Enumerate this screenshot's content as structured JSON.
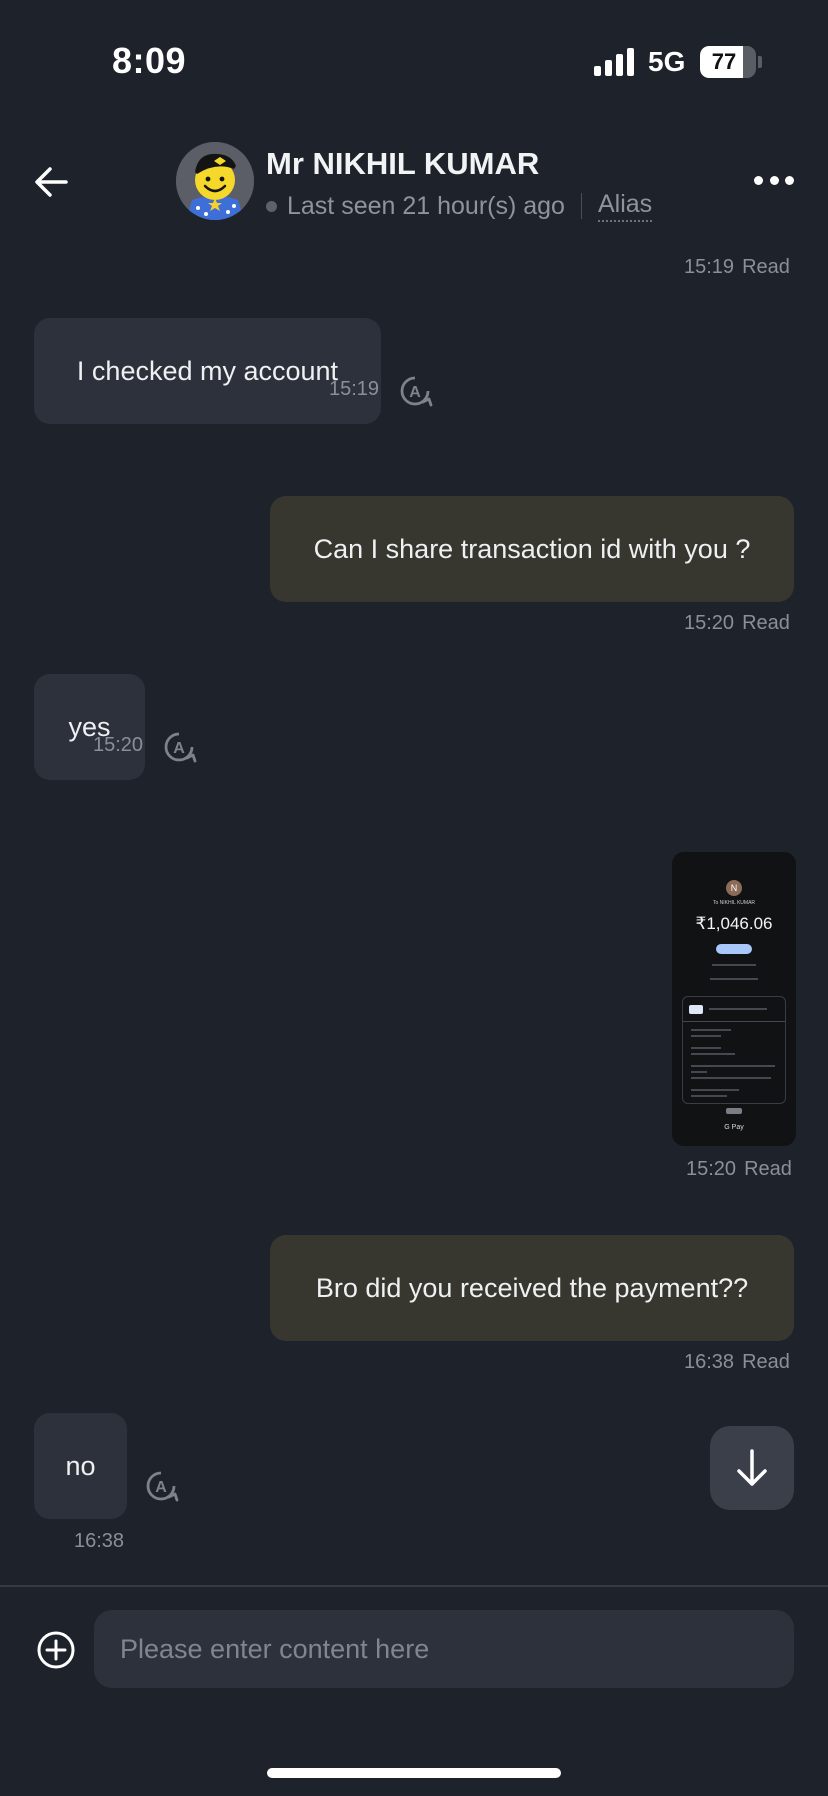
{
  "status_bar": {
    "time": "8:09",
    "network": "5G",
    "battery_level": "77",
    "battery_fraction": 0.77
  },
  "header": {
    "contact_name": "Mr NIKHIL KUMAR",
    "last_seen": "Last seen 21 hour(s) ago",
    "alias_label": "Alias"
  },
  "messages": [
    {
      "direction": "out",
      "time": "15:19",
      "status": "Read"
    },
    {
      "direction": "in",
      "text": "I checked my account",
      "time": "15:19"
    },
    {
      "direction": "out",
      "text": "Can I share transaction id with you ?",
      "time": "15:20",
      "status": "Read"
    },
    {
      "direction": "in",
      "text": "yes",
      "time": "15:20"
    },
    {
      "direction": "out",
      "type": "image",
      "time": "15:20",
      "status": "Read",
      "receipt": {
        "avatar_letter": "N",
        "to": "To NIKHIL KUMAR",
        "amount": "₹1,046.06",
        "footer": "G Pay"
      }
    },
    {
      "direction": "out",
      "text": "Bro did you received the payment??",
      "time": "16:38",
      "status": "Read"
    },
    {
      "direction": "in",
      "text": "no",
      "time": "16:38"
    }
  ],
  "composer": {
    "placeholder": "Please enter content here"
  },
  "icons": {
    "back": "arrow-left-icon",
    "more": "more-horizontal-icon",
    "translate": "auto-translate-icon",
    "scroll_down": "arrow-down-icon",
    "add": "plus-circle-icon"
  },
  "colors": {
    "background": "#1e222b",
    "incoming_bubble": "#2c313c",
    "outgoing_bubble": "#37372f",
    "meta_text": "#8a8f98"
  }
}
